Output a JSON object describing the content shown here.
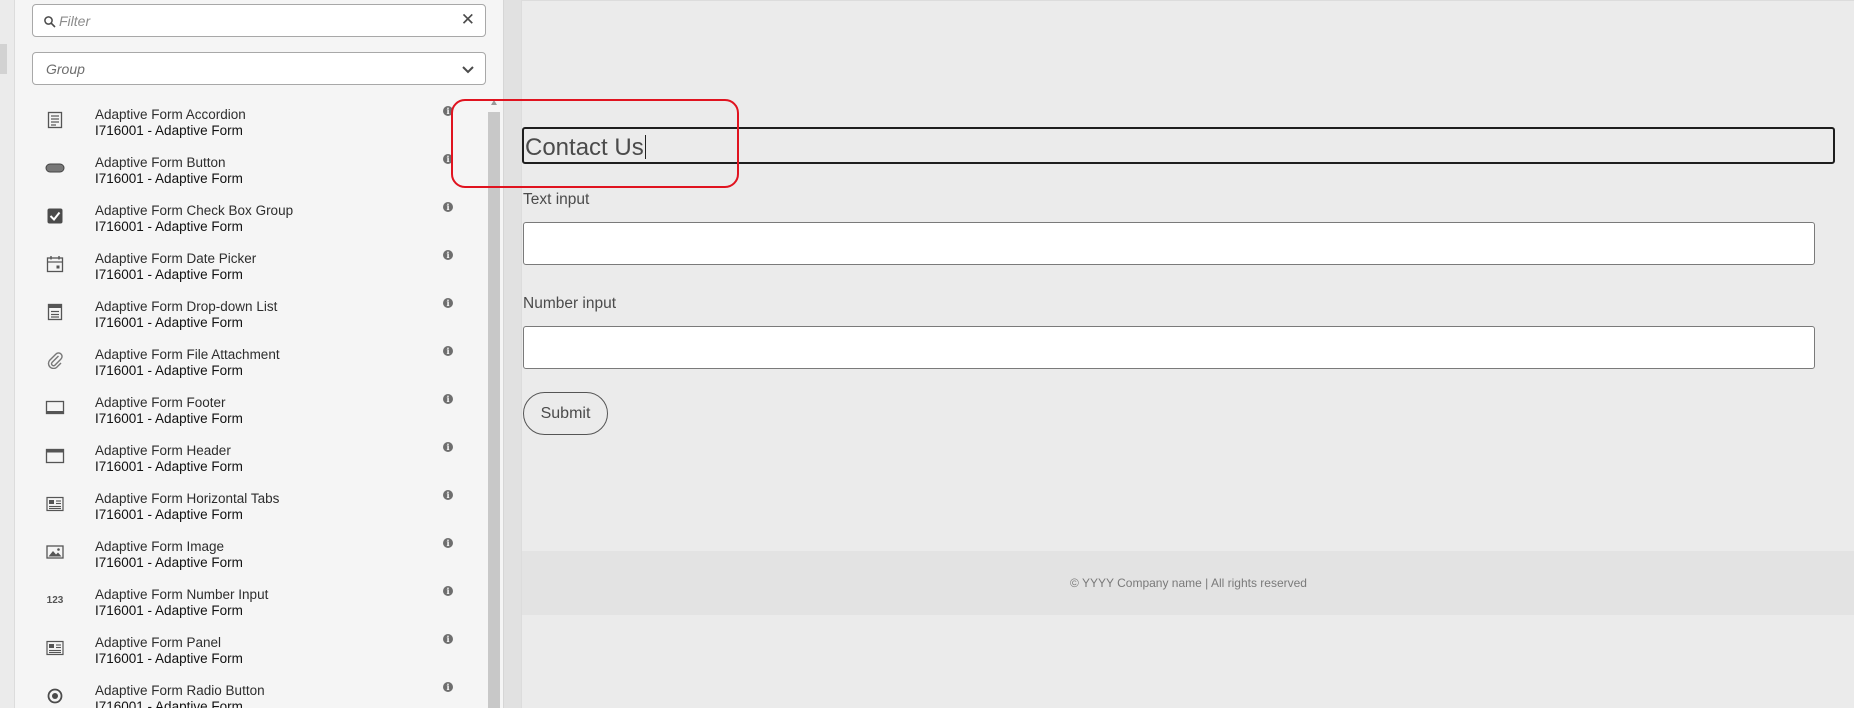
{
  "sidebar": {
    "filter_placeholder": "Filter",
    "group_value": "Group",
    "items": [
      {
        "title": "Adaptive Form Accordion",
        "subtitle": "I716001 - Adaptive Form",
        "icon": "accordion-icon"
      },
      {
        "title": "Adaptive Form Button",
        "subtitle": "I716001 - Adaptive Form",
        "icon": "button-icon"
      },
      {
        "title": "Adaptive Form Check Box Group",
        "subtitle": "I716001 - Adaptive Form",
        "icon": "checkbox-icon"
      },
      {
        "title": "Adaptive Form Date Picker",
        "subtitle": "I716001 - Adaptive Form",
        "icon": "calendar-icon"
      },
      {
        "title": "Adaptive Form Drop-down List",
        "subtitle": "I716001 - Adaptive Form",
        "icon": "dropdown-list-icon"
      },
      {
        "title": "Adaptive Form File Attachment",
        "subtitle": "I716001 - Adaptive Form",
        "icon": "paperclip-icon"
      },
      {
        "title": "Adaptive Form Footer",
        "subtitle": "I716001 - Adaptive Form",
        "icon": "footer-icon"
      },
      {
        "title": "Adaptive Form Header",
        "subtitle": "I716001 - Adaptive Form",
        "icon": "header-icon"
      },
      {
        "title": "Adaptive Form Horizontal Tabs",
        "subtitle": "I716001 - Adaptive Form",
        "icon": "tabs-icon"
      },
      {
        "title": "Adaptive Form Image",
        "subtitle": "I716001 - Adaptive Form",
        "icon": "image-icon"
      },
      {
        "title": "Adaptive Form Number Input",
        "subtitle": "I716001 - Adaptive Form",
        "icon": "number-icon",
        "glyph": "123"
      },
      {
        "title": "Adaptive Form Panel",
        "subtitle": "I716001 - Adaptive Form",
        "icon": "panel-icon"
      },
      {
        "title": "Adaptive Form Radio Button",
        "subtitle": "I716001 - Adaptive Form",
        "icon": "radio-icon"
      }
    ]
  },
  "form": {
    "title": "Contact Us",
    "text_input_label": "Text input",
    "number_input_label": "Number input",
    "submit_label": "Submit",
    "footer_text": "© YYYY Company name | All rights reserved"
  },
  "colors": {
    "highlight": "#e0131f",
    "canvas_bg": "#ebebeb",
    "panel_bg": "#f5f5f5"
  }
}
